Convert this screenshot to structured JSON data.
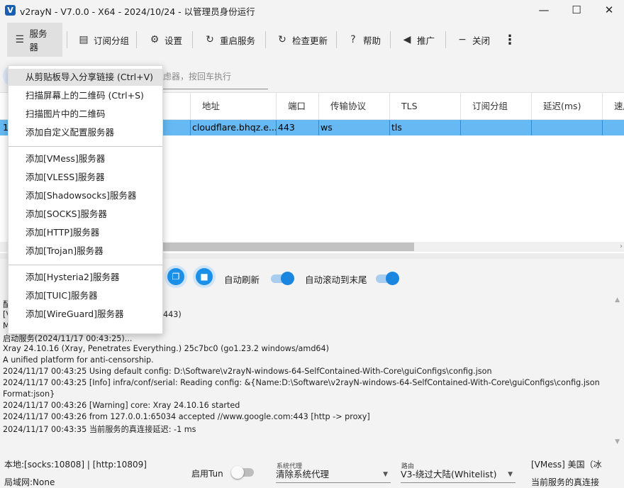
{
  "window": {
    "title": "v2rayN - V7.0.0 - X64 - 2024/10/24 - 以管理员身份运行",
    "logo_letter": "V",
    "minimize": "—",
    "maximize": "☐",
    "close": "✕"
  },
  "toolbar": {
    "servers": "服务器",
    "subscription": "订阅分组",
    "settings": "设置",
    "restart": "重启服务",
    "check_update": "检查更新",
    "help": "帮助",
    "promote": "推广",
    "close": "关闭",
    "more": "⋮"
  },
  "search": {
    "placeholder": "虑器，按回车执行"
  },
  "grid": {
    "columns": [
      "地址",
      "端口",
      "传输协议",
      "TLS",
      "订阅分组",
      "延迟(ms)",
      "速度"
    ],
    "row": {
      "index": "1",
      "address": "cloudflare.bhqz.e...",
      "port": "443",
      "transport": "ws",
      "tls": "tls",
      "subscription": "",
      "delay": "",
      "speed": ""
    }
  },
  "controls": {
    "auto_refresh_label": "自动刷新",
    "auto_refresh_on": true,
    "auto_scroll_label": "自动滚动到末尾",
    "auto_scroll_on": true,
    "copy_icon": "copy-icon",
    "delete_icon": "trash-icon"
  },
  "log": {
    "partial_lines": [
      "配",
      "[V",
      "M"
    ],
    "partial_right": "443)",
    "lines": [
      "启动服务(2024/11/17 00:43:25)...",
      "Xray 24.10.16 (Xray, Penetrates Everything.) 25c7bc0 (go1.23.2 windows/amd64)",
      "A unified platform for anti-censorship.",
      "2024/11/17 00:43:25 Using default config:  D:\\Software\\v2rayN-windows-64-SelfContained-With-Core\\guiConfigs\\config.json",
      "2024/11/17 00:43:25 [Info] infra/conf/serial: Reading config: &{Name:D:\\Software\\v2rayN-windows-64-SelfContained-With-Core\\guiConfigs\\config.json",
      "Format:json}",
      "2024/11/17 00:43:26 [Warning] core: Xray 24.10.16 started",
      "2024/11/17 00:43:26 from 127.0.0.1:65034 accepted //www.google.com:443 [http -> proxy]",
      "2024/11/17 00:43:35 当前服务的真连接延迟: -1 ms"
    ]
  },
  "status": {
    "local": "本地:[socks:10808] | [http:10809]",
    "lan": "局域网:None",
    "tun_label": "启用Tun",
    "tun_on": false,
    "sysproxy_caption": "系统代理",
    "sysproxy_value": "清除系统代理",
    "routing_caption": "路由",
    "routing_value": "V3-绕过大陆(Whitelist)",
    "server_info": "[VMess] 美国（冰",
    "delay_info": "当前服务的真连接"
  },
  "menu": {
    "items": [
      "从剪贴板导入分享链接 (Ctrl+V)",
      "扫描屏幕上的二维码 (Ctrl+S)",
      "扫描图片中的二维码",
      "添加自定义配置服务器",
      "添加[VMess]服务器",
      "添加[VLESS]服务器",
      "添加[Shadowsocks]服务器",
      "添加[SOCKS]服务器",
      "添加[HTTP]服务器",
      "添加[Trojan]服务器",
      "添加[Hysteria2]服务器",
      "添加[TUIC]服务器",
      "添加[WireGuard]服务器"
    ]
  },
  "colors": {
    "accent": "#1b86e0",
    "row_selected": "#66b9f2",
    "toolbar_active": "#e0e0e0"
  }
}
